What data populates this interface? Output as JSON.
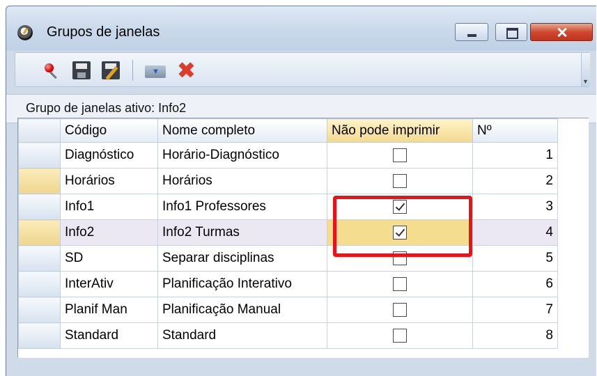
{
  "window": {
    "title": "Grupos de janelas"
  },
  "toolbar": {
    "icons": [
      "pin-icon",
      "save-icon",
      "save-edit-icon",
      "folder-down-icon",
      "delete-icon"
    ],
    "overflow_glyph": "▼"
  },
  "status": {
    "text": "Grupo de janelas ativo: Info2"
  },
  "grid": {
    "columns": [
      "Código",
      "Nome completo",
      "Não pode imprimir",
      "Nº"
    ],
    "rows": [
      {
        "codigo": "Diagnóstico",
        "nome": "Horário-Diagnóstico",
        "nao_pode_imprimir": false,
        "num": "1"
      },
      {
        "codigo": "Horários",
        "nome": "Horários",
        "nao_pode_imprimir": false,
        "num": "2"
      },
      {
        "codigo": "Info1",
        "nome": "Info1 Professores",
        "nao_pode_imprimir": true,
        "num": "3"
      },
      {
        "codigo": "Info2",
        "nome": "Info2 Turmas",
        "nao_pode_imprimir": true,
        "num": "4"
      },
      {
        "codigo": "SD",
        "nome": "Separar disciplinas",
        "nao_pode_imprimir": false,
        "num": "5"
      },
      {
        "codigo": "InterAtiv",
        "nome": "Planificação Interativo",
        "nao_pode_imprimir": false,
        "num": "6"
      },
      {
        "codigo": "Planif Man",
        "nome": "Planificação Manual",
        "nao_pode_imprimir": false,
        "num": "7"
      },
      {
        "codigo": "Standard",
        "nome": "Standard",
        "nao_pode_imprimir": false,
        "num": "8"
      }
    ]
  },
  "colors": {
    "highlight": "#e8141a",
    "selected_row": "#ebe8f4",
    "selected_header": "#f3d98e"
  }
}
